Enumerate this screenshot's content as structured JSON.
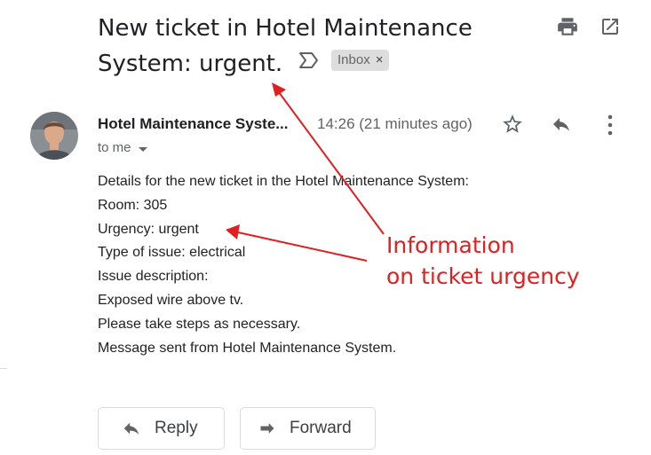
{
  "email": {
    "subject_line1": "New ticket in Hotel Maintenance",
    "subject_line2": "System: urgent.",
    "label": "Inbox",
    "label_close": "×",
    "sender": "Hotel Maintenance Syste...",
    "time": "14:26 (21 minutes ago)",
    "recipient": "to me",
    "body_lines": [
      "Details for the new ticket in the Hotel Maintenance System:",
      "Room: 305",
      "Urgency: urgent",
      "Type of issue: electrical",
      "Issue description:",
      "Exposed wire above tv.",
      "Please take steps as necessary.",
      "Message sent from Hotel Maintenance System."
    ]
  },
  "actions": {
    "reply_label": "Reply",
    "forward_label": "Forward"
  },
  "annotation": {
    "line1": "Information",
    "line2": "on ticket urgency",
    "color": "#e02020"
  },
  "icons": {
    "print": "print-icon",
    "open_new_window": "open-in-new-window-icon",
    "important_marker": "importance-marker-icon",
    "star": "star-icon",
    "reply": "reply-icon",
    "more": "more-vertical-icon",
    "forward": "forward-icon"
  }
}
